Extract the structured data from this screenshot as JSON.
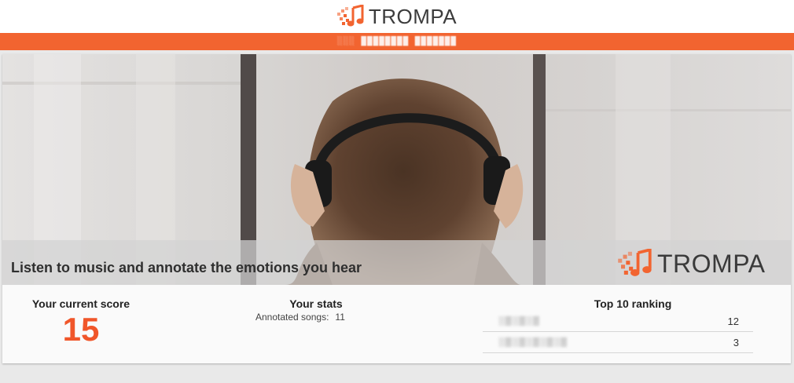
{
  "header": {
    "logo_text": "TROMPA",
    "notice_text": "░░░ ████████ ███████"
  },
  "hero": {
    "tagline": "Listen to music and annotate the emotions you hear",
    "logo_text": "TROMPA"
  },
  "score": {
    "title": "Your current score",
    "value": "15"
  },
  "stats": {
    "title": "Your stats",
    "annotated_label": "Annotated songs:",
    "annotated_value": "11"
  },
  "ranking": {
    "title": "Top 10 ranking",
    "rows": [
      {
        "name": "░▒░▒░▒",
        "score": "12"
      },
      {
        "name": "░▒░▒░▒░▒░▒",
        "score": "3"
      }
    ]
  },
  "colors": {
    "brand_orange": "#f26430",
    "score_orange": "#f0562a"
  },
  "icons": {
    "logo": "music-note-icon"
  }
}
